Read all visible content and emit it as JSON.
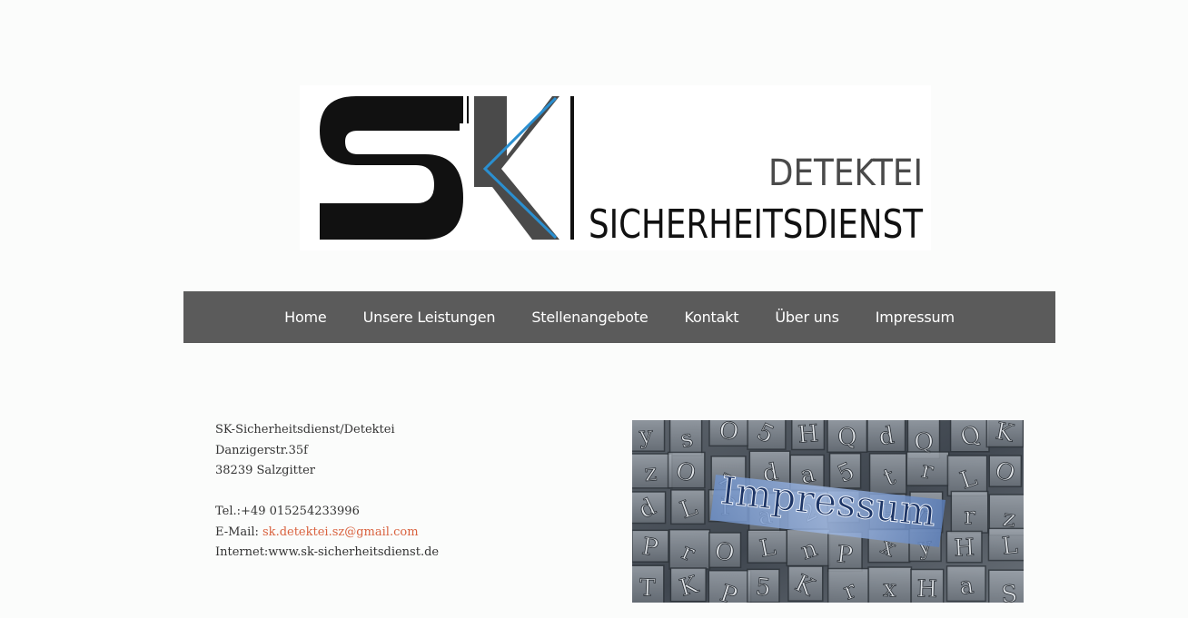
{
  "logo": {
    "letters": "SK",
    "line1": "DETEKTEI",
    "line2": "SICHERHEITSDIENST"
  },
  "nav": {
    "items": [
      {
        "label": "Home"
      },
      {
        "label": "Unsere Leistungen"
      },
      {
        "label": "Stellenangebote"
      },
      {
        "label": "Kontakt"
      },
      {
        "label": "Über uns"
      },
      {
        "label": "Impressum"
      }
    ]
  },
  "address": {
    "company": "SK-Sicherheitsdienst/Detektei",
    "street": "Danzigerstr.35f",
    "city": "38239 Salzgitter",
    "phone": "Tel.:+49 015254233996",
    "email_label": "E-Mail: ",
    "email": "sk.detektei.sz@gmail.com",
    "internet": "Internet:www.sk-sicherheitsdienst.de"
  },
  "image": {
    "caption": "Impressum"
  },
  "colors": {
    "nav_bg": "#5b5b5b",
    "link": "#d9623f",
    "logo_blue": "#2a8fd0"
  }
}
